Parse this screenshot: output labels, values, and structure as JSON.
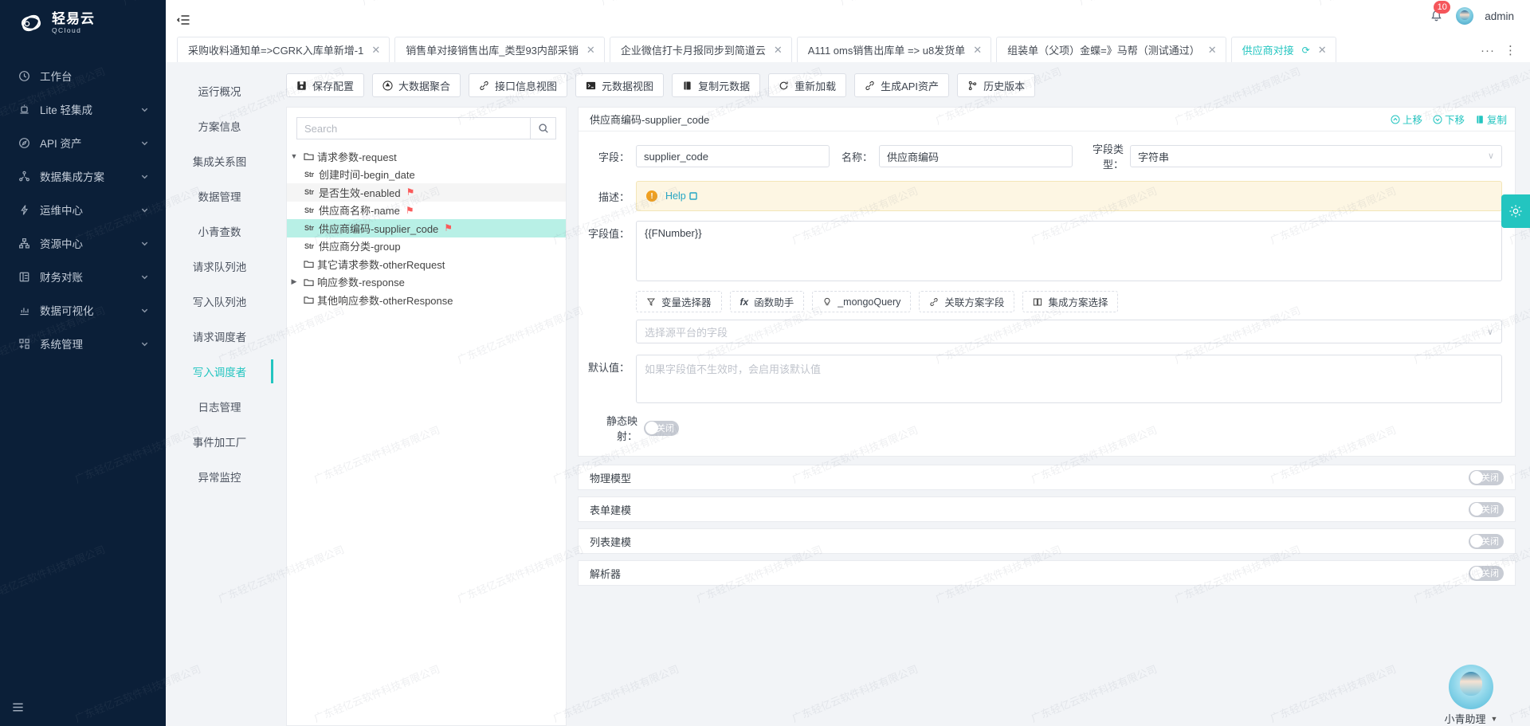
{
  "brand": {
    "cn": "轻易云",
    "en": "QCloud"
  },
  "sidebar": {
    "items": [
      {
        "label": "工作台",
        "icon": "clock-icon",
        "expandable": false
      },
      {
        "label": "Lite 轻集成",
        "icon": "lamp-icon",
        "expandable": true
      },
      {
        "label": "API 资产",
        "icon": "compass-icon",
        "expandable": true
      },
      {
        "label": "数据集成方案",
        "icon": "share-nodes-icon",
        "expandable": true
      },
      {
        "label": "运维中心",
        "icon": "bolt-icon",
        "expandable": true
      },
      {
        "label": "资源中心",
        "icon": "sitemap-icon",
        "expandable": true
      },
      {
        "label": "财务对账",
        "icon": "ledger-icon",
        "expandable": true
      },
      {
        "label": "数据可视化",
        "icon": "bar-chart-icon",
        "expandable": true
      },
      {
        "label": "系统管理",
        "icon": "grid-plus-icon",
        "expandable": true
      }
    ]
  },
  "topbar": {
    "notification_count": "10",
    "user": "admin"
  },
  "tabs": [
    {
      "label": "采购收料通知单=>CGRK入库单新增-1",
      "active": false,
      "closable": true
    },
    {
      "label": "销售单对接销售出库_类型93内部采销",
      "active": false,
      "closable": true
    },
    {
      "label": "企业微信打卡月报同步到简道云",
      "active": false,
      "closable": true
    },
    {
      "label": "A111 oms销售出库单 => u8发货单",
      "active": false,
      "closable": true
    },
    {
      "label": "组装单（父项）金蝶=》马帮（测试通过）",
      "active": false,
      "closable": true
    },
    {
      "label": "供应商对接",
      "active": true,
      "closable": true,
      "refresh": true
    }
  ],
  "submenu": {
    "items": [
      {
        "label": "运行概况",
        "active": false
      },
      {
        "label": "方案信息",
        "active": false
      },
      {
        "label": "集成关系图",
        "active": false
      },
      {
        "label": "数据管理",
        "active": false
      },
      {
        "label": "小青查数",
        "active": false
      },
      {
        "label": "请求队列池",
        "active": false
      },
      {
        "label": "写入队列池",
        "active": false
      },
      {
        "label": "请求调度者",
        "active": false
      },
      {
        "label": "写入调度者",
        "active": true
      },
      {
        "label": "日志管理",
        "active": false
      },
      {
        "label": "事件加工厂",
        "active": false
      },
      {
        "label": "异常监控",
        "active": false
      }
    ]
  },
  "toolbar": {
    "buttons": [
      {
        "label": "保存配置",
        "icon": "save-icon"
      },
      {
        "label": "大数据聚合",
        "icon": "aggregate-icon"
      },
      {
        "label": "接口信息视图",
        "icon": "link-icon"
      },
      {
        "label": "元数据视图",
        "icon": "terminal-icon"
      },
      {
        "label": "复制元数据",
        "icon": "copy-icon"
      },
      {
        "label": "重新加载",
        "icon": "refresh-icon"
      },
      {
        "label": "生成API资产",
        "icon": "link-icon"
      },
      {
        "label": "历史版本",
        "icon": "branch-icon"
      }
    ]
  },
  "tree_panel": {
    "search_placeholder": "Search",
    "search_value": "",
    "nodes": [
      {
        "label": "请求参数-request",
        "type": "folder",
        "depth": 0,
        "expanded": true,
        "caret": "down",
        "flag": false,
        "state": "normal"
      },
      {
        "label": "创建时间-begin_date",
        "type": "str",
        "depth": 1,
        "flag": false,
        "state": "normal"
      },
      {
        "label": "是否生效-enabled",
        "type": "str",
        "depth": 1,
        "flag": true,
        "state": "hover"
      },
      {
        "label": "供应商名称-name",
        "type": "str",
        "depth": 1,
        "flag": true,
        "state": "normal"
      },
      {
        "label": "供应商编码-supplier_code",
        "type": "str",
        "depth": 1,
        "flag": true,
        "state": "selected"
      },
      {
        "label": "供应商分类-group",
        "type": "str",
        "depth": 1,
        "flag": false,
        "state": "normal"
      },
      {
        "label": "其它请求参数-otherRequest",
        "type": "folder",
        "depth": 0,
        "expanded": false,
        "caret": "none",
        "flag": false,
        "state": "normal"
      },
      {
        "label": "响应参数-response",
        "type": "folder",
        "depth": 0,
        "expanded": false,
        "caret": "right",
        "flag": false,
        "state": "normal"
      },
      {
        "label": "其他响应参数-otherResponse",
        "type": "folder",
        "depth": 0,
        "expanded": false,
        "caret": "none",
        "flag": false,
        "state": "normal"
      }
    ]
  },
  "detail": {
    "title": "供应商编码-supplier_code",
    "actions": [
      {
        "label": "上移",
        "icon": "move-up-icon"
      },
      {
        "label": "下移",
        "icon": "move-down-icon"
      },
      {
        "label": "复制",
        "icon": "copy-icon"
      }
    ],
    "field_label": "字段：",
    "field_value": "supplier_code",
    "name_label": "名称：",
    "name_value": "供应商编码",
    "type_label": "字段类型：",
    "type_value": "字符串",
    "desc_label": "描述：",
    "desc_help": "Help",
    "value_label": "字段值：",
    "value_text": "{{FNumber}}",
    "chips": [
      {
        "label": "变量选择器",
        "icon": "filter-icon"
      },
      {
        "label": "函数助手",
        "icon": "fx-icon"
      },
      {
        "label": "_mongoQuery",
        "icon": "bulb-icon"
      },
      {
        "label": "关联方案字段",
        "icon": "link-icon"
      },
      {
        "label": "集成方案选择",
        "icon": "grid-icon"
      }
    ],
    "source_select_placeholder": "选择源平台的字段",
    "default_label": "默认值：",
    "default_placeholder": "如果字段值不生效时，会启用该默认值",
    "static_map_label": "静态映射：",
    "static_map_state": "关闭"
  },
  "sections": [
    {
      "title": "物理模型",
      "state": "关闭"
    },
    {
      "title": "表单建模",
      "state": "关闭"
    },
    {
      "title": "列表建模",
      "state": "关闭"
    },
    {
      "title": "解析器",
      "state": "关闭"
    }
  ],
  "assistant": {
    "name": "小青助理"
  },
  "colors": {
    "accent": "#23c5c0",
    "sidebar": "#0b1f38",
    "badge": "#f5565b",
    "flag": "#fa5a5a",
    "selected_row": "#b8f0e6"
  },
  "watermark": {
    "text": "广东轻亿云软件科技有限公司"
  }
}
